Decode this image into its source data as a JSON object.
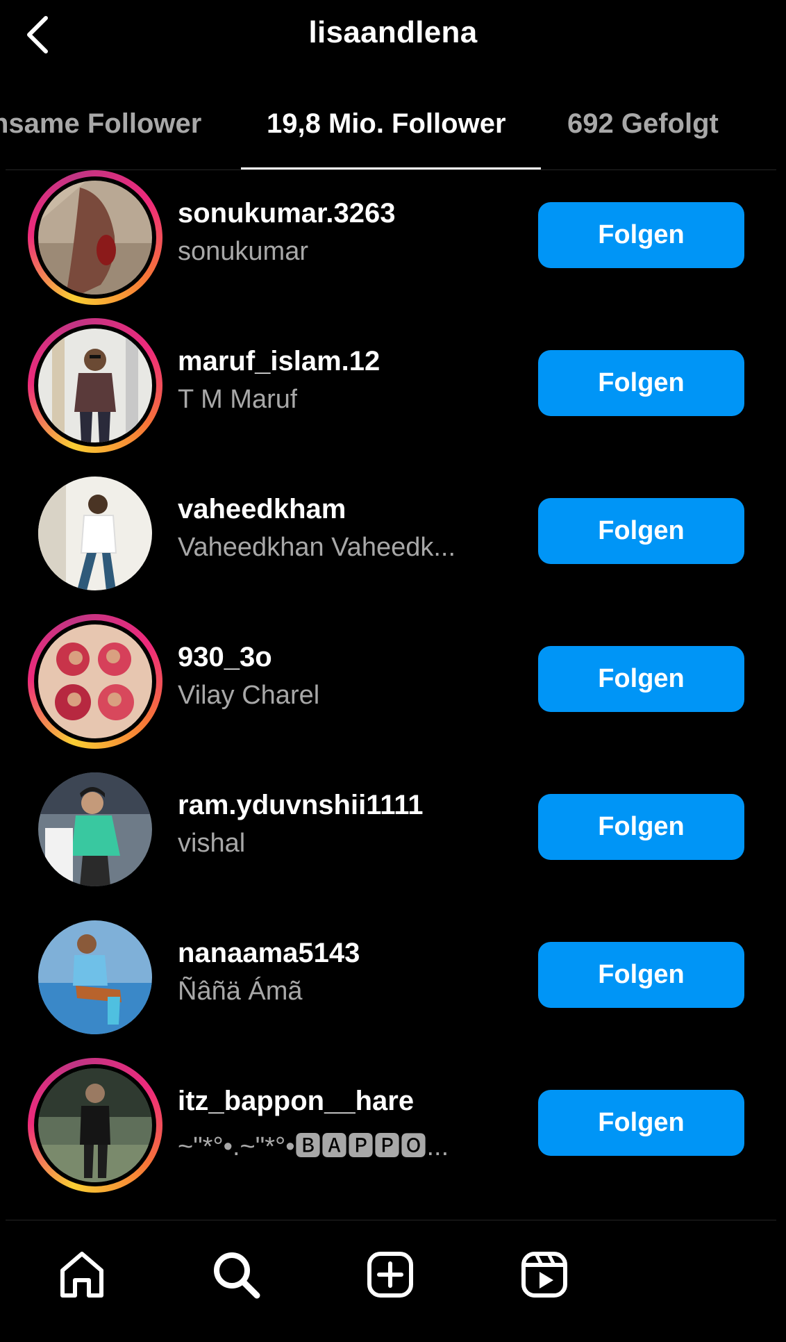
{
  "header": {
    "title": "lisaandlena",
    "back_icon": "chevron-left-icon"
  },
  "tabs": [
    {
      "label": "nsame Follower",
      "active": false
    },
    {
      "label": "19,8 Mio. Follower",
      "active": true
    },
    {
      "label": "692 Gefolgt",
      "active": false
    }
  ],
  "followers": [
    {
      "username": "sonukumar.3263",
      "full_name": "sonukumar",
      "button": "Folgen",
      "has_story": true
    },
    {
      "username": "maruf_islam.12",
      "full_name": "T M Maruf",
      "button": "Folgen",
      "has_story": true
    },
    {
      "username": "vaheedkham",
      "full_name": "Vaheedkhan Vaheedk...",
      "button": "Folgen",
      "has_story": false
    },
    {
      "username": "930_3o",
      "full_name": "Vilay Charel",
      "button": "Folgen",
      "has_story": true
    },
    {
      "username": "ram.yduvnshii1111",
      "full_name": "vishal",
      "button": "Folgen",
      "has_story": false
    },
    {
      "username": "nanaama5143",
      "full_name": "Ñâñä Ámã",
      "button": "Folgen",
      "has_story": false
    },
    {
      "username": "itz_bappon__hare",
      "full_name": "~\"*°•.~\"*°•🅱🅰🅿🅿🅾...",
      "button": "Folgen",
      "has_story": true
    }
  ],
  "bottom_nav": [
    "home-icon",
    "search-icon",
    "create-post-icon",
    "reels-icon"
  ],
  "colors": {
    "background": "#000000",
    "primary_button": "#0095f6",
    "secondary_text": "#a8a8a8",
    "divider": "#262626"
  }
}
